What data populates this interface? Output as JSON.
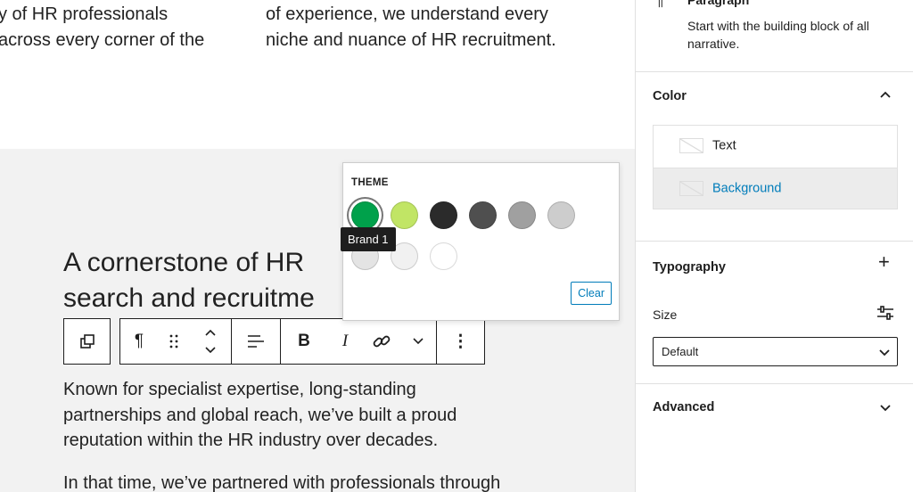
{
  "editor": {
    "top_col1": [
      "y of HR professionals",
      "across every corner of the"
    ],
    "top_col2": [
      "of experience, we understand every",
      "niche and nuance of HR recruitment."
    ],
    "heading": [
      "A cornerstone of HR",
      "search and recruitme"
    ],
    "body1": [
      "Known for specialist expertise, long-standing",
      "partnerships and global reach, we’ve built a proud",
      "reputation within the HR industry over decades."
    ],
    "body2": "In that time, we’ve partnered with professionals through"
  },
  "toolbar": {
    "paragraph": "¶",
    "bold": "B",
    "italic": "I",
    "more": "⋮"
  },
  "popover": {
    "section": "THEME",
    "tooltip": "Brand 1",
    "clear": "Clear",
    "swatches": [
      {
        "name": "Brand 1",
        "color": "#00a14b",
        "selected": true
      },
      {
        "color": "#c1e565"
      },
      {
        "color": "#2b2b2b"
      },
      {
        "color": "#4f4f4f"
      },
      {
        "color": "#a0a0a0"
      },
      {
        "color": "#cdcdcd"
      },
      {
        "color": "#e4e4e4"
      },
      {
        "color": "#f1f1f1"
      },
      {
        "color": "#ffffff"
      }
    ]
  },
  "sidebar": {
    "block_title": "Paragraph",
    "block_desc": [
      "Start with the building block of all",
      "narrative."
    ],
    "color": {
      "title": "Color",
      "text": "Text",
      "background": "Background"
    },
    "typography": {
      "title": "Typography",
      "size_label": "Size",
      "size_value": "Default"
    },
    "advanced": "Advanced"
  },
  "colors": {
    "accent": "#007cba"
  }
}
